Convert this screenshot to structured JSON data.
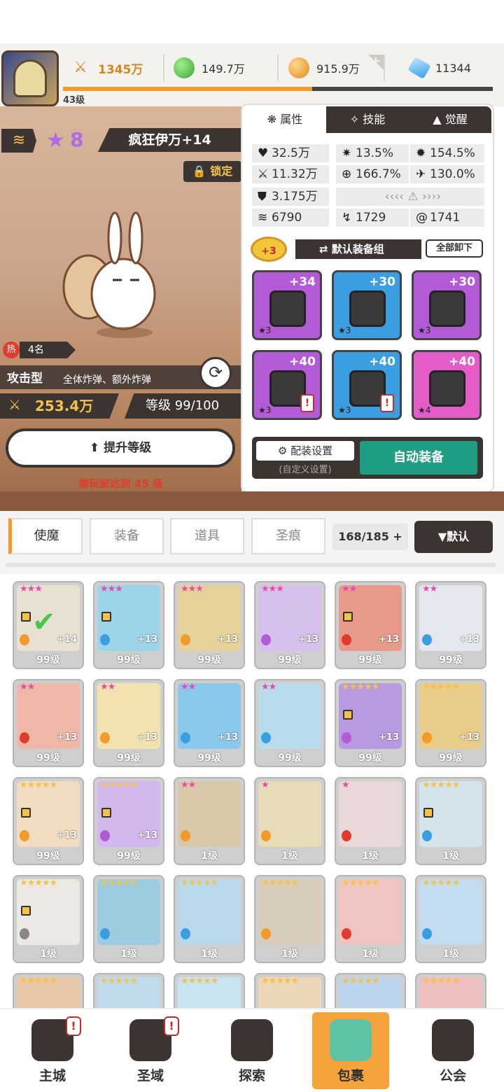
{
  "top": {
    "level": "43级",
    "power": "1345万",
    "gold": "149.7万",
    "coin": "915.9万",
    "gem": "11344",
    "xp_progress": 0.58
  },
  "hero": {
    "star_count": "8",
    "name": "疯狂伊万+14",
    "lock_label": "锁定",
    "hot_label": "热",
    "hot_rank": "4名",
    "type": "攻击型",
    "type_desc": "全体炸弹、额外炸弹",
    "power": "253.4万",
    "level": "等级 99/100",
    "upgrade_label": "提升等级",
    "requirement": "需玩家达到 45 级"
  },
  "panel": {
    "tabs": [
      "属性",
      "技能",
      "觉醒"
    ],
    "stats": [
      {
        "icon": "heart-icon",
        "glyph": "♥",
        "value": "32.5万"
      },
      {
        "icon": "crit-icon",
        "glyph": "✷",
        "value": "13.5%"
      },
      {
        "icon": "critdmg-icon",
        "glyph": "✹",
        "value": "154.5%"
      },
      {
        "icon": "attack-icon",
        "glyph": "⚔",
        "value": "11.32万"
      },
      {
        "icon": "accuracy-icon",
        "glyph": "⊕",
        "value": "166.7%"
      },
      {
        "icon": "speed-icon",
        "glyph": "✈",
        "value": "130.0%"
      },
      {
        "icon": "shield-icon",
        "glyph": "⛊",
        "value": "3.175万"
      },
      {
        "icon": "wind-icon",
        "glyph": "≋",
        "value": "6790"
      },
      {
        "icon": "dodge-icon",
        "glyph": "↯",
        "value": "1729"
      },
      {
        "icon": "swirl-icon",
        "glyph": "@",
        "value": "1741"
      }
    ],
    "equip_bonus": "+3",
    "equip_group": "默认装备组",
    "unequip_all": "全部卸下",
    "equipment": [
      {
        "name": "sword",
        "level": "+34",
        "stars": "★3",
        "bg": "#b35ad6",
        "warn": false
      },
      {
        "name": "helmet",
        "level": "+30",
        "stars": "★3",
        "bg": "#3a9ee0",
        "warn": false
      },
      {
        "name": "armor",
        "level": "+30",
        "stars": "★3",
        "bg": "#b35ad6",
        "warn": false
      },
      {
        "name": "belt",
        "level": "+40",
        "stars": "★3",
        "bg": "#b35ad6",
        "warn": true
      },
      {
        "name": "necklace",
        "level": "+40",
        "stars": "★3",
        "bg": "#3a9ee0",
        "warn": true
      },
      {
        "name": "boots",
        "level": "+40",
        "stars": "★4",
        "bg": "#e35cc8",
        "warn": false
      }
    ],
    "config_label": "配装设置",
    "config_sub": "(自定义设置)",
    "auto_equip": "自动装备"
  },
  "categories": {
    "tabs": [
      "使魔",
      "装备",
      "道具",
      "圣痕"
    ],
    "count": "168/185",
    "sort": "▼默认"
  },
  "grid": {
    "cards": [
      {
        "stars": "★★★",
        "plus": "+14",
        "level": "99级",
        "color": "#e8e0d0",
        "el": "#f29a2a",
        "locked": true,
        "check": true
      },
      {
        "stars": "★★★",
        "plus": "+13",
        "level": "99级",
        "color": "#9ed4ea",
        "el": "#3a9ee0",
        "locked": true
      },
      {
        "stars": "★★★",
        "plus": "+13",
        "level": "99级",
        "color": "#e4d29a",
        "el": "#f29a2a",
        "locked": false
      },
      {
        "stars": "★★★",
        "plus": "+13",
        "level": "99级",
        "color": "#d6c0ec",
        "el": "#b35ad6",
        "locked": false
      },
      {
        "stars": "★★",
        "plus": "+13",
        "level": "99级",
        "color": "#e89a8a",
        "el": "#e03c2e",
        "locked": true
      },
      {
        "stars": "★★",
        "plus": "+13",
        "level": "99级",
        "color": "#e4e8ee",
        "el": "#3a9ee0",
        "locked": false
      },
      {
        "stars": "★★",
        "plus": "+13",
        "level": "99级",
        "color": "#f0b8a8",
        "el": "#e03c2e",
        "locked": false
      },
      {
        "stars": "★★",
        "plus": "+13",
        "level": "99级",
        "color": "#f2e2b0",
        "el": "#f29a2a",
        "locked": false
      },
      {
        "stars": "★★",
        "plus": "+13",
        "level": "99级",
        "color": "#8ac8ec",
        "el": "#3a9ee0",
        "locked": false
      },
      {
        "stars": "★★",
        "plus": "",
        "level": "99级",
        "color": "#b8dcec",
        "el": "#3a9ee0",
        "locked": false
      },
      {
        "stars": "★★★★★",
        "plus": "+13",
        "level": "99级",
        "color": "#b89ae0",
        "el": "#b35ad6",
        "locked": true
      },
      {
        "stars": "★★★★★",
        "plus": "+13",
        "level": "99级",
        "color": "#e8cc88",
        "el": "#f29a2a",
        "locked": false
      },
      {
        "stars": "★★★★★",
        "plus": "+13",
        "level": "99级",
        "color": "#f0dcc0",
        "el": "#f29a2a",
        "locked": true
      },
      {
        "stars": "★★★★★",
        "plus": "+13",
        "level": "99级",
        "color": "#d2b8ec",
        "el": "#b35ad6",
        "locked": true
      },
      {
        "stars": "★★",
        "plus": "",
        "level": "1级",
        "color": "#d8c8a8",
        "el": "#f29a2a",
        "locked": false
      },
      {
        "stars": "★",
        "plus": "",
        "level": "1级",
        "color": "#e8dcb8",
        "el": "#f29a2a",
        "locked": false
      },
      {
        "stars": "★",
        "plus": "",
        "level": "1级",
        "color": "#e8d8d8",
        "el": "#e03c2e",
        "locked": false
      },
      {
        "stars": "★★★★★",
        "plus": "",
        "level": "1级",
        "color": "#d4e4ec",
        "el": "#3a9ee0",
        "locked": true
      },
      {
        "stars": "★★★★★",
        "plus": "",
        "level": "1级",
        "color": "#ece8e4",
        "el": "#888888",
        "locked": true
      },
      {
        "stars": "★★★★★",
        "plus": "",
        "level": "1级",
        "color": "#9ccce0",
        "el": "#3a9ee0",
        "locked": false
      },
      {
        "stars": "★★★★★",
        "plus": "",
        "level": "1级",
        "color": "#b8d8ec",
        "el": "#3a9ee0",
        "locked": false
      },
      {
        "stars": "★★★★★",
        "plus": "",
        "level": "1级",
        "color": "#d8ccbc",
        "el": "#f29a2a",
        "locked": false
      },
      {
        "stars": "★★★★★",
        "plus": "",
        "level": "1级",
        "color": "#f0c4c0",
        "el": "#e03c2e",
        "locked": false
      },
      {
        "stars": "★★★★★",
        "plus": "",
        "level": "1级",
        "color": "#c4dcf0",
        "el": "#3a9ee0",
        "locked": false
      },
      {
        "stars": "★★★★★",
        "plus": "",
        "level": "",
        "color": "#e8c8a8",
        "el": "",
        "locked": false
      },
      {
        "stars": "★★★★★",
        "plus": "",
        "level": "",
        "color": "#c0dcec",
        "el": "",
        "locked": false
      },
      {
        "stars": "★★★★★",
        "plus": "",
        "level": "",
        "color": "#c8e4f0",
        "el": "",
        "locked": false
      },
      {
        "stars": "★★★★★",
        "plus": "",
        "level": "",
        "color": "#ecd8b8",
        "el": "",
        "locked": false
      },
      {
        "stars": "★★★★★",
        "plus": "",
        "level": "",
        "color": "#bcd4ec",
        "el": "",
        "locked": false
      },
      {
        "stars": "★★★★★",
        "plus": "",
        "level": "",
        "color": "#f0c0c0",
        "el": "",
        "locked": false
      }
    ]
  },
  "nav": [
    {
      "label": "主城",
      "badge": "!"
    },
    {
      "label": "圣域",
      "badge": "!"
    },
    {
      "label": "探索",
      "badge": ""
    },
    {
      "label": "包裹",
      "badge": ""
    },
    {
      "label": "公会",
      "badge": ""
    }
  ]
}
